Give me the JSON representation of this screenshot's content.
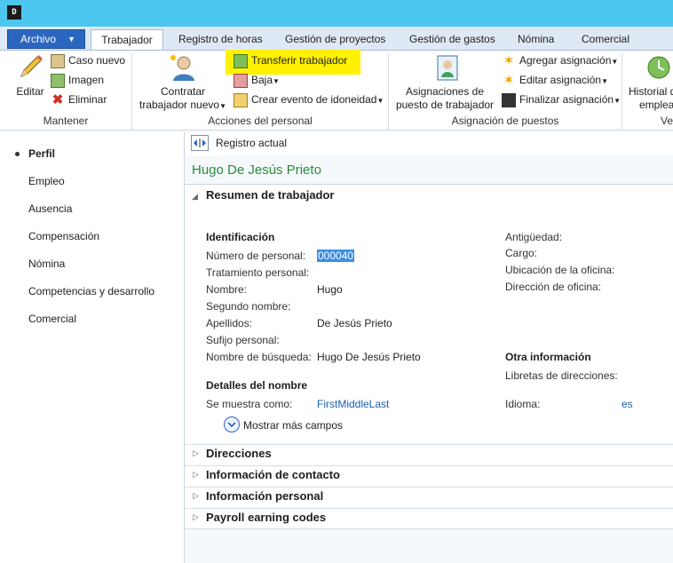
{
  "tabs": {
    "archivo": "Archivo",
    "items": [
      "Trabajador",
      "Registro de horas",
      "Gestión de proyectos",
      "Gestión de gastos",
      "Nómina",
      "Comercial"
    ]
  },
  "ribbon": {
    "mantener": {
      "label": "Mantener",
      "editar": "Editar",
      "caso_nuevo": "Caso nuevo",
      "imagen": "Imagen",
      "eliminar": "Eliminar"
    },
    "acciones": {
      "label": "Acciones del personal",
      "contratar_1": "Contratar",
      "contratar_2": "trabajador nuevo",
      "transferir": "Transferir trabajador",
      "baja": "Baja",
      "crear_evento": "Crear evento de idoneidad"
    },
    "asignacion": {
      "label": "Asignación de puestos",
      "asignaciones_1": "Asignaciones de",
      "asignaciones_2": "puesto de trabajador",
      "agregar": "Agregar asignación",
      "editar": "Editar asignación",
      "finalizar": "Finalizar asignación"
    },
    "historial": {
      "label_1": "Historial d",
      "label_2": "emplea",
      "group_label": "Ve"
    }
  },
  "nav": {
    "items": [
      "Perfil",
      "Empleo",
      "Ausencia",
      "Compensación",
      "Nómina",
      "Competencias y desarrollo",
      "Comercial"
    ]
  },
  "record": {
    "toolbar_label": "Registro actual",
    "worker_name": "Hugo De Jesús Prieto"
  },
  "summary": {
    "header": "Resumen de trabajador",
    "identificacion": "Identificación",
    "fields": [
      {
        "label": "Número de personal:",
        "value": "000040"
      },
      {
        "label": "Tratamiento personal:",
        "value": ""
      },
      {
        "label": "Nombre:",
        "value": "Hugo"
      },
      {
        "label": "Segundo nombre:",
        "value": ""
      },
      {
        "label": "Apellidos:",
        "value": "De Jesús Prieto"
      },
      {
        "label": "Sufijo personal:",
        "value": ""
      },
      {
        "label": "Nombre de búsqueda:",
        "value": "Hugo De Jesús Prieto"
      }
    ],
    "detalles": "Detalles del nombre",
    "se_muestra_label": "Se muestra como:",
    "se_muestra_value": "FirstMiddleLast",
    "mostrar_mas": "Mostrar más campos",
    "right_fields": [
      "Antigüedad:",
      "Cargo:",
      "Ubicación de la oficina:",
      "Dirección de oficina:"
    ],
    "otra_info": "Otra información",
    "libretas": "Libretas de direcciones:",
    "idioma_label": "Idioma:",
    "idioma_value": "es"
  },
  "fasttabs": [
    "Direcciones",
    "Información de contacto",
    "Información personal",
    "Payroll earning codes"
  ],
  "colors": {
    "titlebar": "#4cc7f0",
    "archivo": "#2b66c1",
    "highlight": "#fff100",
    "worker_name": "#2a8c3a",
    "link": "#1c5fb0"
  }
}
